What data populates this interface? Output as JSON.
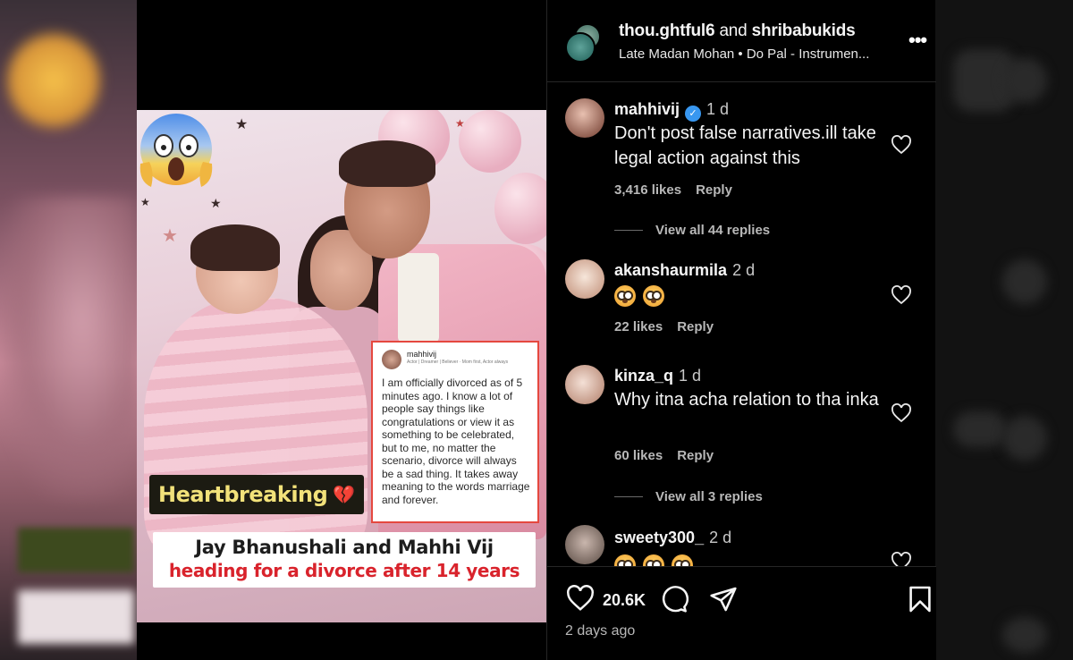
{
  "post": {
    "header": {
      "user1": "thou.ghtful6",
      "conjunction": "and",
      "user2": "shribabukids",
      "music": "Late Madan Mohan • Do Pal - Instrumen...",
      "more_icon": "more-options-icon"
    },
    "image": {
      "tweet": {
        "username": "mahhivij",
        "bio": "Actor | Dreamer | Believer · Mom first, Actor always",
        "text": "I am officially divorced as of 5 minutes ago. I know a lot of people say things like congratulations or view it as something to be celebrated, but to me, no matter the scenario, divorce will always be a sad thing. It takes away meaning to the words marriage and forever."
      },
      "label": "Heartbreaking",
      "label_emoji": "💔",
      "banner_line1": "Jay Bhanushali and Mahhi Vij",
      "banner_line2": "heading for a divorce after 14 years"
    },
    "comments": [
      {
        "user": "mahhivij",
        "verified": true,
        "time": "1 d",
        "text": "Don't post false narratives.ill take legal action against this",
        "likes": "3,416 likes",
        "reply": "Reply",
        "view_replies": "View all 44 replies"
      },
      {
        "user": "akanshaurmila",
        "time": "2 d",
        "text": "😳 😳",
        "likes": "22 likes",
        "reply": "Reply"
      },
      {
        "user": "kinza_q",
        "time": "1 d",
        "text": "Why itna acha relation to tha inka",
        "likes": "60 likes",
        "reply": "Reply",
        "view_replies": "View all 3 replies"
      },
      {
        "user": "sweety300_",
        "time": "2 d",
        "text": "😳 😳 😳"
      }
    ],
    "footer": {
      "like_count": "20.6K",
      "posted": "2 days ago"
    },
    "colors": {
      "verified": "#3897f0",
      "banner_red": "#d9232c",
      "label_yellow": "#f2e27a",
      "background": "#000000"
    }
  }
}
